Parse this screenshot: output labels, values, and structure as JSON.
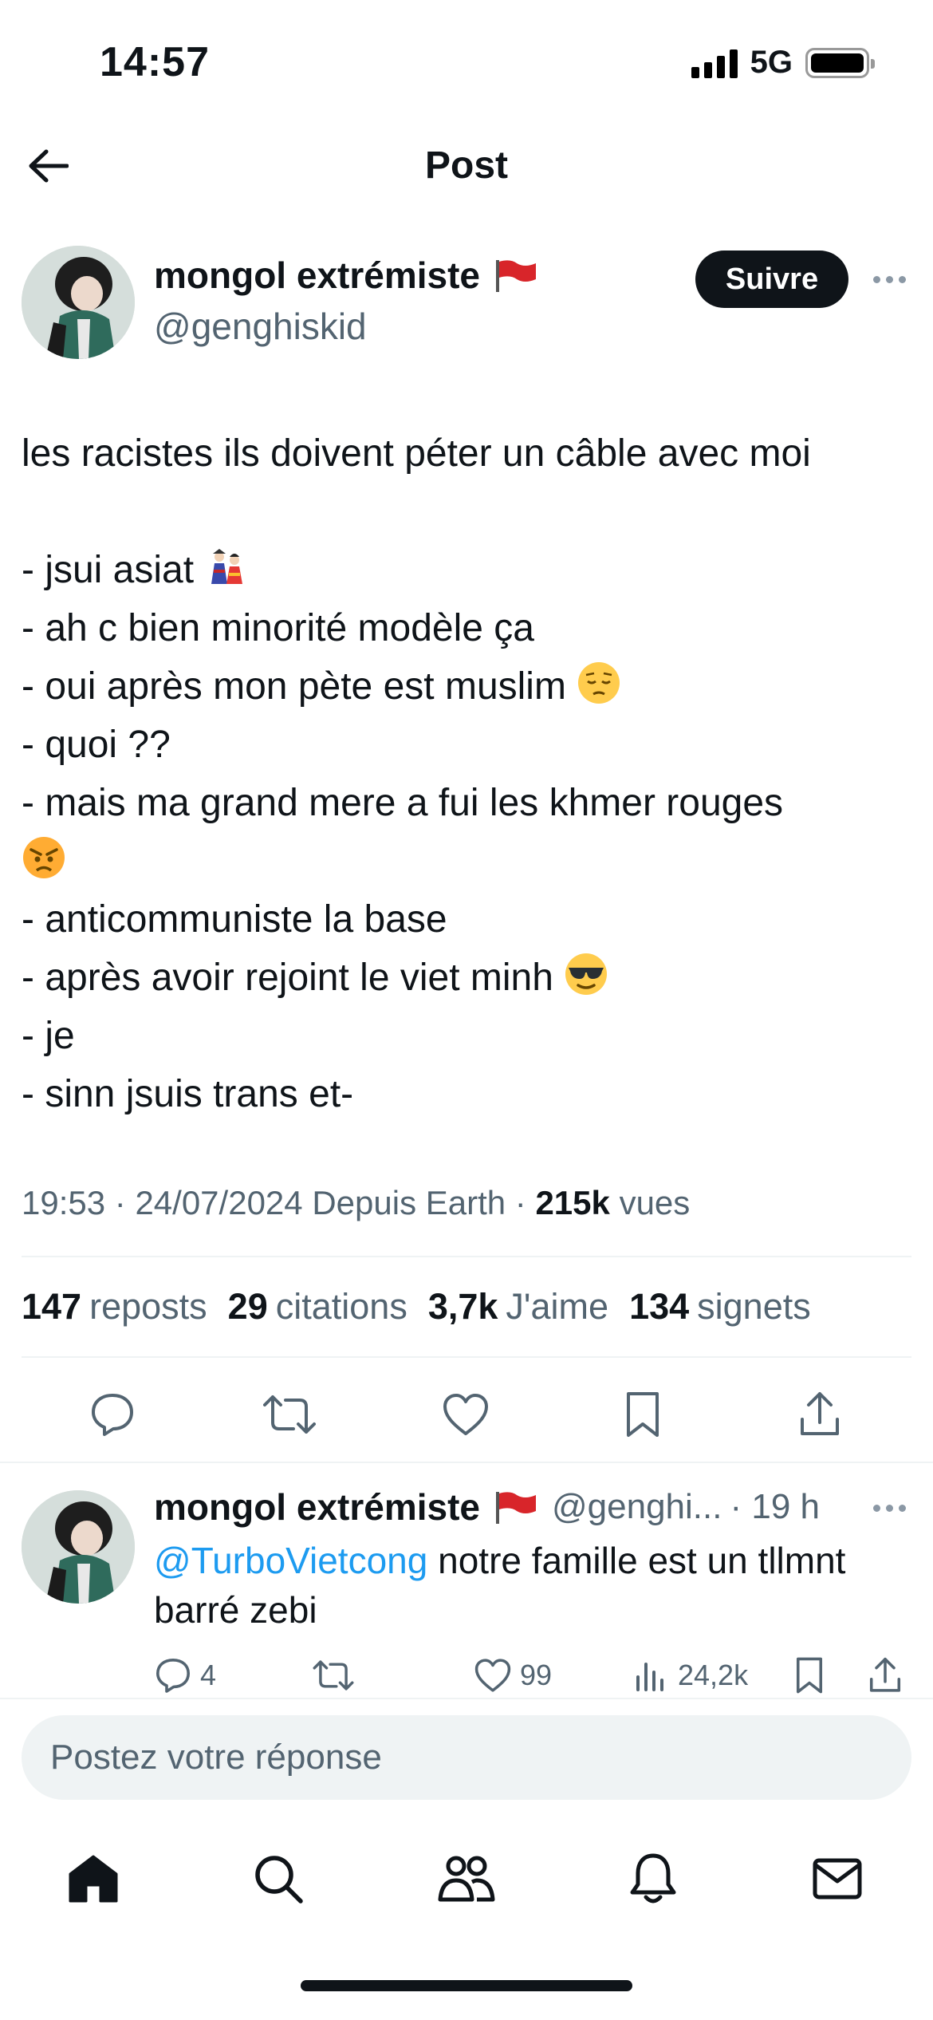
{
  "status_bar": {
    "time": "14:57",
    "network": "5G",
    "battery_level": 0.85
  },
  "header": {
    "title": "Post"
  },
  "tweet": {
    "author_name": "mongol extrémiste",
    "author_handle": "@genghiskid",
    "follow_label": "Suivre",
    "lines": [
      "les racistes ils doivent péter un câble avec moi",
      "",
      "- jsui asiat",
      "- ah c bien minorité modèle ça",
      "- oui après mon pète est muslim",
      "- quoi ??",
      "- mais ma grand mere a fui les khmer rouges",
      "",
      "- anticommuniste la base",
      "- après avoir rejoint le viet minh",
      "- je",
      "- sinn jsuis trans et-"
    ],
    "meta": {
      "time": "19:53",
      "date": "24/07/2024",
      "source": "Depuis Earth",
      "views_count": "215k",
      "views_label": "vues"
    },
    "stats": [
      {
        "count": "147",
        "label": "reposts"
      },
      {
        "count": "29",
        "label": "citations"
      },
      {
        "count": "3,7k",
        "label": "J'aime"
      },
      {
        "count": "134",
        "label": "signets"
      }
    ]
  },
  "reply": {
    "author_name": "mongol extrémiste",
    "author_handle": "@genghi...",
    "time": "· 19 h",
    "mention": "@TurboVietcong",
    "text_line1": " notre famille est un tllmnt",
    "text_line2": "barré zebi",
    "reply_count": "4",
    "like_count": "99",
    "view_count": "24,2k"
  },
  "composer": {
    "placeholder": "Postez votre réponse"
  },
  "colors": {
    "primary_text": "#0f1419",
    "secondary_text": "#536471",
    "link": "#1d9bf0",
    "divider": "#eff3f4",
    "flag_red": "#d8252a"
  }
}
